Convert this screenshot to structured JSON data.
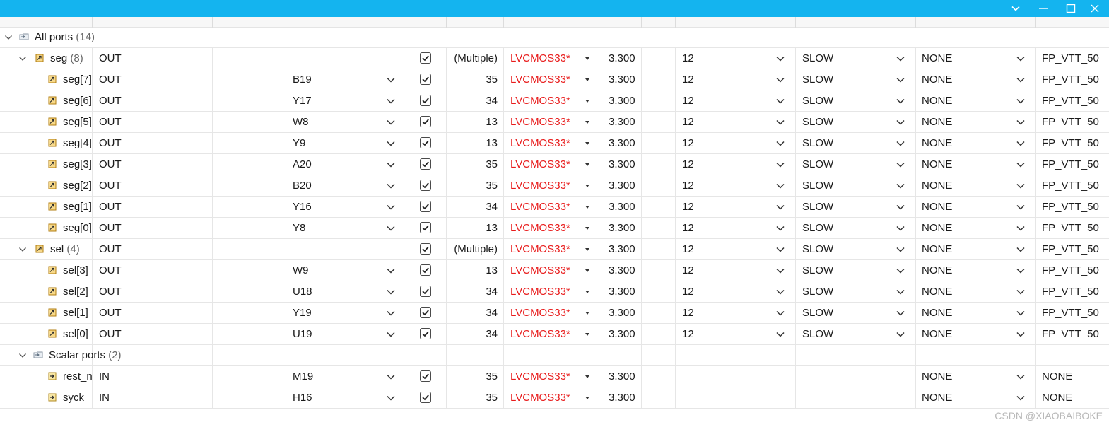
{
  "window": {
    "accent": "#14b4ef",
    "controls": [
      "chevron-down-icon",
      "minimize-icon",
      "maximize-icon",
      "close-icon"
    ]
  },
  "colors": {
    "io_std_red": "#e81b1b",
    "count_gray": "#666666"
  },
  "rows": [
    {
      "kind": "root",
      "level": 0,
      "name": "All ports",
      "count": "(14)",
      "icon": "folder-ports-icon"
    },
    {
      "kind": "group",
      "level": 1,
      "name": "seg",
      "count": "(8)",
      "icon": "bus-out-icon",
      "dir": "OUT",
      "pkg_pin": "",
      "fixed": true,
      "bank": "(Multiple)",
      "io_std": "LVCMOS33*",
      "vcco": "3.300",
      "drive": "12",
      "slew": "SLOW",
      "pull": "NONE",
      "odt": "FP_VTT_50"
    },
    {
      "kind": "port",
      "level": 2,
      "name": "seg[7]",
      "icon": "port-out-icon",
      "dir": "OUT",
      "pkg_pin": "B19",
      "fixed": true,
      "bank": "35",
      "io_std": "LVCMOS33*",
      "vcco": "3.300",
      "drive": "12",
      "slew": "SLOW",
      "pull": "NONE",
      "odt": "FP_VTT_50"
    },
    {
      "kind": "port",
      "level": 2,
      "name": "seg[6]",
      "icon": "port-out-icon",
      "dir": "OUT",
      "pkg_pin": "Y17",
      "fixed": true,
      "bank": "34",
      "io_std": "LVCMOS33*",
      "vcco": "3.300",
      "drive": "12",
      "slew": "SLOW",
      "pull": "NONE",
      "odt": "FP_VTT_50"
    },
    {
      "kind": "port",
      "level": 2,
      "name": "seg[5]",
      "icon": "port-out-icon",
      "dir": "OUT",
      "pkg_pin": "W8",
      "fixed": true,
      "bank": "13",
      "io_std": "LVCMOS33*",
      "vcco": "3.300",
      "drive": "12",
      "slew": "SLOW",
      "pull": "NONE",
      "odt": "FP_VTT_50"
    },
    {
      "kind": "port",
      "level": 2,
      "name": "seg[4]",
      "icon": "port-out-icon",
      "dir": "OUT",
      "pkg_pin": "Y9",
      "fixed": true,
      "bank": "13",
      "io_std": "LVCMOS33*",
      "vcco": "3.300",
      "drive": "12",
      "slew": "SLOW",
      "pull": "NONE",
      "odt": "FP_VTT_50"
    },
    {
      "kind": "port",
      "level": 2,
      "name": "seg[3]",
      "icon": "port-out-icon",
      "dir": "OUT",
      "pkg_pin": "A20",
      "fixed": true,
      "bank": "35",
      "io_std": "LVCMOS33*",
      "vcco": "3.300",
      "drive": "12",
      "slew": "SLOW",
      "pull": "NONE",
      "odt": "FP_VTT_50"
    },
    {
      "kind": "port",
      "level": 2,
      "name": "seg[2]",
      "icon": "port-out-icon",
      "dir": "OUT",
      "pkg_pin": "B20",
      "fixed": true,
      "bank": "35",
      "io_std": "LVCMOS33*",
      "vcco": "3.300",
      "drive": "12",
      "slew": "SLOW",
      "pull": "NONE",
      "odt": "FP_VTT_50"
    },
    {
      "kind": "port",
      "level": 2,
      "name": "seg[1]",
      "icon": "port-out-icon",
      "dir": "OUT",
      "pkg_pin": "Y16",
      "fixed": true,
      "bank": "34",
      "io_std": "LVCMOS33*",
      "vcco": "3.300",
      "drive": "12",
      "slew": "SLOW",
      "pull": "NONE",
      "odt": "FP_VTT_50"
    },
    {
      "kind": "port",
      "level": 2,
      "name": "seg[0]",
      "icon": "port-out-icon",
      "dir": "OUT",
      "pkg_pin": "Y8",
      "fixed": true,
      "bank": "13",
      "io_std": "LVCMOS33*",
      "vcco": "3.300",
      "drive": "12",
      "slew": "SLOW",
      "pull": "NONE",
      "odt": "FP_VTT_50"
    },
    {
      "kind": "group",
      "level": 1,
      "name": "sel",
      "count": "(4)",
      "icon": "bus-out-icon",
      "dir": "OUT",
      "pkg_pin": "",
      "fixed": true,
      "bank": "(Multiple)",
      "io_std": "LVCMOS33*",
      "vcco": "3.300",
      "drive": "12",
      "slew": "SLOW",
      "pull": "NONE",
      "odt": "FP_VTT_50"
    },
    {
      "kind": "port",
      "level": 2,
      "name": "sel[3]",
      "icon": "port-out-icon",
      "dir": "OUT",
      "pkg_pin": "W9",
      "fixed": true,
      "bank": "13",
      "io_std": "LVCMOS33*",
      "vcco": "3.300",
      "drive": "12",
      "slew": "SLOW",
      "pull": "NONE",
      "odt": "FP_VTT_50"
    },
    {
      "kind": "port",
      "level": 2,
      "name": "sel[2]",
      "icon": "port-out-icon",
      "dir": "OUT",
      "pkg_pin": "U18",
      "fixed": true,
      "bank": "34",
      "io_std": "LVCMOS33*",
      "vcco": "3.300",
      "drive": "12",
      "slew": "SLOW",
      "pull": "NONE",
      "odt": "FP_VTT_50"
    },
    {
      "kind": "port",
      "level": 2,
      "name": "sel[1]",
      "icon": "port-out-icon",
      "dir": "OUT",
      "pkg_pin": "Y19",
      "fixed": true,
      "bank": "34",
      "io_std": "LVCMOS33*",
      "vcco": "3.300",
      "drive": "12",
      "slew": "SLOW",
      "pull": "NONE",
      "odt": "FP_VTT_50"
    },
    {
      "kind": "port",
      "level": 2,
      "name": "sel[0]",
      "icon": "port-out-icon",
      "dir": "OUT",
      "pkg_pin": "U19",
      "fixed": true,
      "bank": "34",
      "io_std": "LVCMOS33*",
      "vcco": "3.300",
      "drive": "12",
      "slew": "SLOW",
      "pull": "NONE",
      "odt": "FP_VTT_50"
    },
    {
      "kind": "root",
      "level": 1,
      "name": "Scalar ports",
      "count": "(2)",
      "icon": "folder-ports-icon"
    },
    {
      "kind": "port",
      "level": 2,
      "name": "rest_n",
      "icon": "port-in-icon",
      "dir": "IN",
      "pkg_pin": "M19",
      "fixed": true,
      "bank": "35",
      "io_std": "LVCMOS33*",
      "vcco": "3.300",
      "drive": "",
      "slew": "",
      "pull": "NONE",
      "odt": "NONE"
    },
    {
      "kind": "port",
      "level": 2,
      "name": "syck",
      "icon": "port-in-icon",
      "dir": "IN",
      "pkg_pin": "H16",
      "fixed": true,
      "bank": "35",
      "io_std": "LVCMOS33*",
      "vcco": "3.300",
      "drive": "",
      "slew": "",
      "pull": "NONE",
      "odt": "NONE"
    }
  ],
  "watermark": "CSDN @XIAOBAIBOKE"
}
